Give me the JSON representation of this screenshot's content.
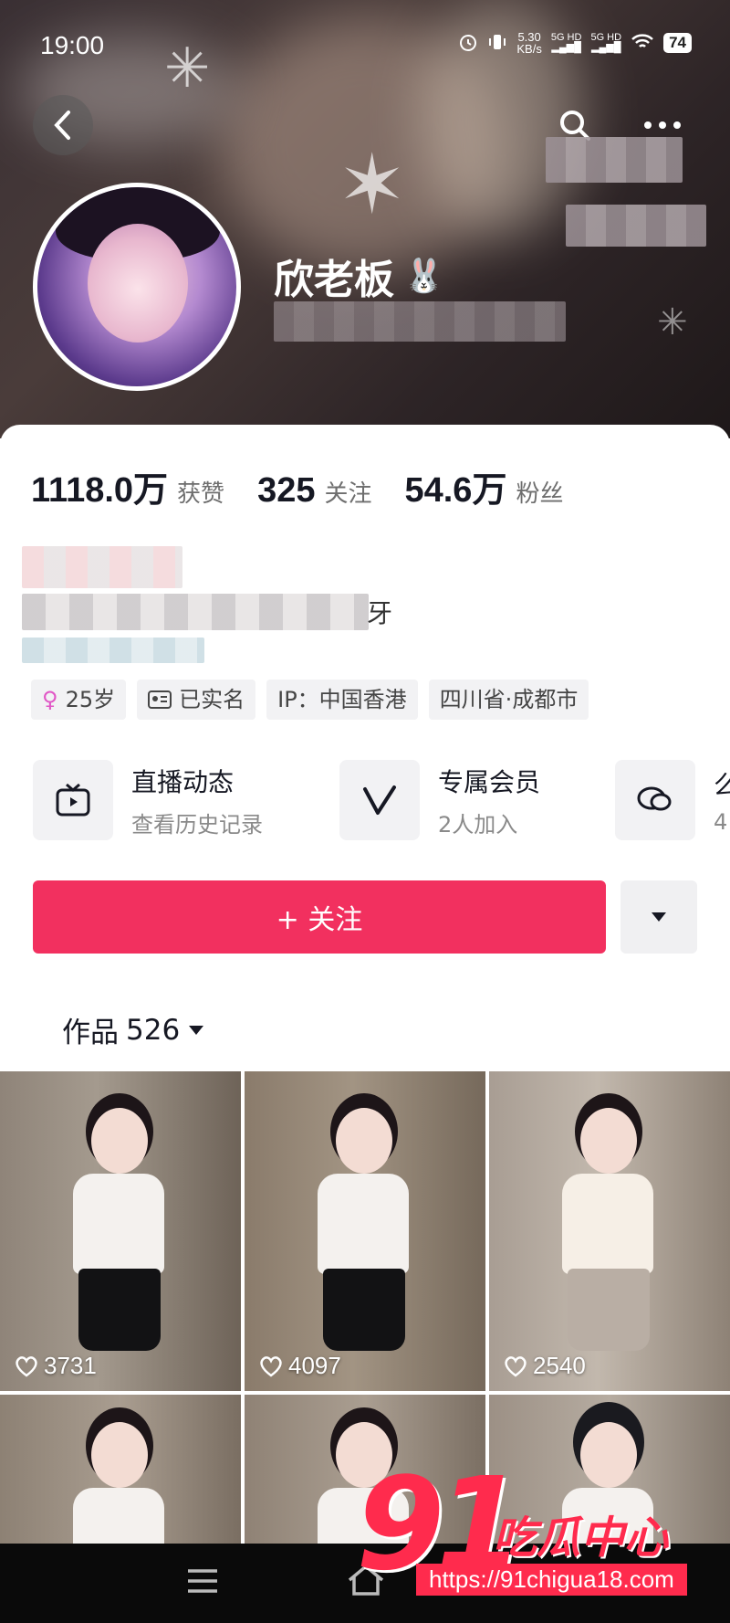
{
  "status_bar": {
    "time": "19:00",
    "net_speed": "5.30",
    "net_unit": "KB/s",
    "sim1": "5G HD",
    "sim2": "5G HD",
    "battery": "74"
  },
  "profile": {
    "username": "欣老板",
    "username_emoji": "🐰"
  },
  "stats": [
    {
      "value": "1118.0万",
      "label": "获赞"
    },
    {
      "value": "325",
      "label": "关注"
    },
    {
      "value": "54.6万",
      "label": "粉丝"
    }
  ],
  "tags": {
    "age": "25岁",
    "verified": "已实名",
    "ip": "IP：中国香港",
    "location": "四川省·成都市"
  },
  "features": [
    {
      "title": "直播动态",
      "subtitle": "查看历史记录",
      "icon": "tv-icon"
    },
    {
      "title": "专属会员",
      "subtitle": "2人加入",
      "icon": "v-icon"
    },
    {
      "title": "么",
      "subtitle": "4",
      "icon": "chat-bubble-icon"
    }
  ],
  "bio_fragment": "牙",
  "follow_button": "+ 关注",
  "works": {
    "label": "作品",
    "count": "526"
  },
  "videos": [
    {
      "likes": "3731"
    },
    {
      "likes": "4097"
    },
    {
      "likes": "2540"
    },
    {
      "likes": ""
    },
    {
      "likes": ""
    },
    {
      "likes": ""
    }
  ],
  "watermark": {
    "big": "91",
    "cn": "吃瓜中心",
    "url": "https://91chigua18.com"
  },
  "colors": {
    "accent": "#f2305f",
    "watermark": "#ff2b4d"
  }
}
